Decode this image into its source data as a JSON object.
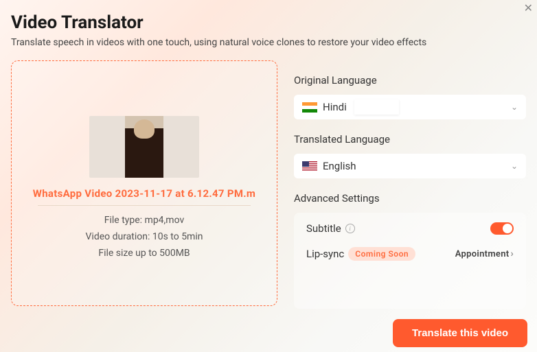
{
  "header": {
    "title": "Video Translator",
    "subtitle": "Translate speech in videos with one touch, using natural voice clones to restore your video effects"
  },
  "upload": {
    "filename": "WhatsApp Video 2023-11-17 at 6.12.47 PM.m",
    "file_type": "File type: mp4,mov",
    "duration": "Video duration: 10s to 5min",
    "size": "File size up to  500MB"
  },
  "settings": {
    "original_label": "Original Language",
    "original_value": "Hindi",
    "translated_label": "Translated Language",
    "translated_value": "English",
    "advanced_label": "Advanced Settings",
    "subtitle_label": "Subtitle",
    "lipsync_label": "Lip-sync",
    "coming_soon": "Coming Soon",
    "appointment": "Appointment"
  },
  "action": {
    "translate": "Translate this video"
  }
}
